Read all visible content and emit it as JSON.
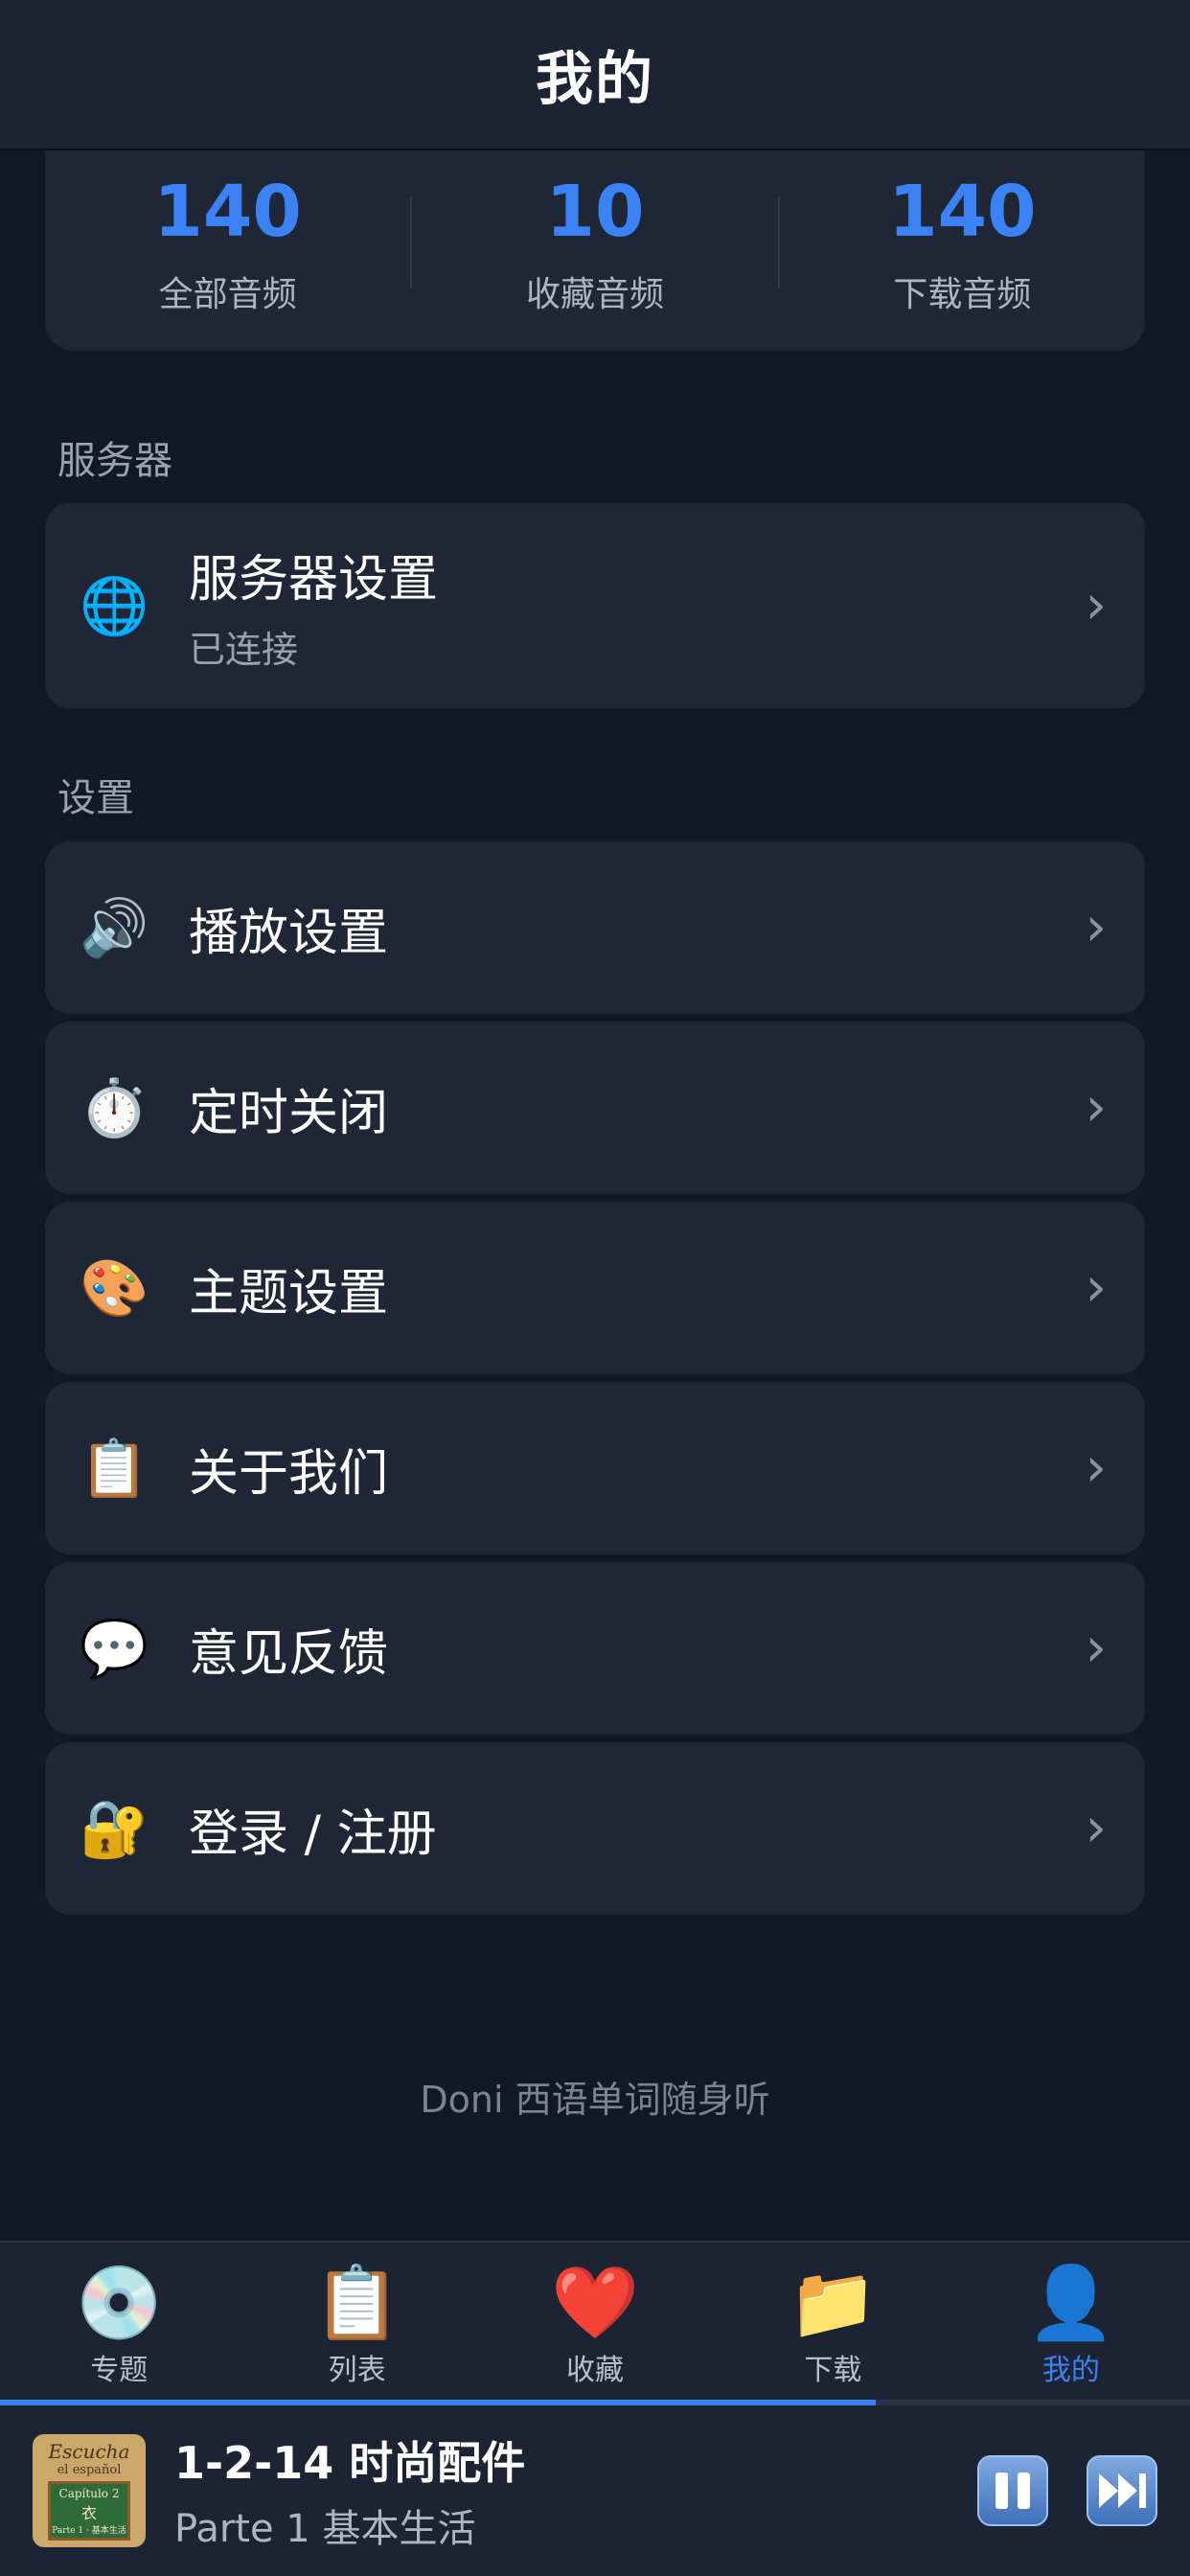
{
  "header": {
    "title": "我的"
  },
  "stats": [
    {
      "value": "140",
      "label": "全部音频"
    },
    {
      "value": "10",
      "label": "收藏音频"
    },
    {
      "value": "140",
      "label": "下载音频"
    }
  ],
  "server_section": {
    "label": "服务器",
    "item": {
      "icon": "globe-icon",
      "title": "服务器设置",
      "status": "已连接"
    }
  },
  "settings_section": {
    "label": "设置",
    "items": [
      {
        "icon": "speaker-icon",
        "title": "播放设置"
      },
      {
        "icon": "stopwatch-icon",
        "title": "定时关闭"
      },
      {
        "icon": "palette-icon",
        "title": "主题设置"
      },
      {
        "icon": "clipboard-icon",
        "title": "关于我们"
      },
      {
        "icon": "speech-bubble-icon",
        "title": "意见反馈"
      },
      {
        "icon": "lock-key-icon",
        "title": "登录 / 注册"
      }
    ]
  },
  "footer": {
    "text": "Doni 西语单词随身听"
  },
  "tabbar": {
    "items": [
      {
        "icon": "disc-icon",
        "label": "专题"
      },
      {
        "icon": "clipboard-icon",
        "label": "列表"
      },
      {
        "icon": "heart-icon",
        "label": "收藏"
      },
      {
        "icon": "folder-icon",
        "label": "下载"
      },
      {
        "icon": "user-icon",
        "label": "我的",
        "active": true
      }
    ]
  },
  "player": {
    "title": "1-2-14 时尚配件",
    "subtitle": "Parte 1 基本生活",
    "progress": 0.736,
    "cover": {
      "line1": "Escucha",
      "line2": "el español",
      "plate1": "Capítulo 2",
      "plate2": "衣",
      "plate3": "Parte 1 · 基本生活"
    }
  },
  "colors": {
    "accent": "#3b82f6",
    "background": "#111827",
    "card": "#1f2737",
    "bar": "#1c2333"
  }
}
